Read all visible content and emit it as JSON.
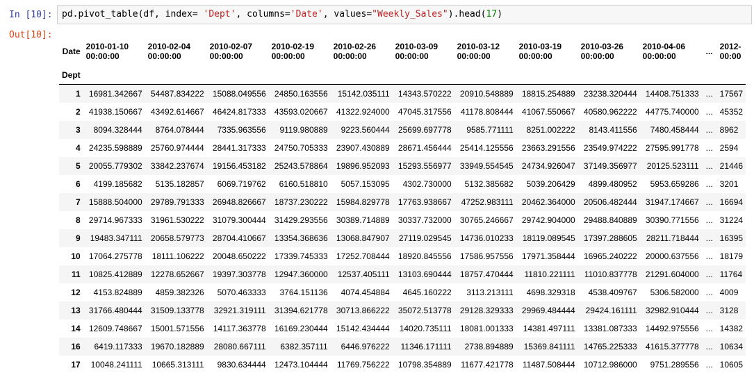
{
  "cell": {
    "in_prompt": "In [10]:",
    "out_prompt": "Out[10]:",
    "code": {
      "p1": "pd.pivot_table(df, index= ",
      "s1": "'Dept'",
      "p2": ", columns=",
      "s2": "'Date'",
      "p3": ", values=",
      "s3": "\"Weekly_Sales\"",
      "p4": ").head(",
      "n1": "17",
      "p5": ")"
    }
  },
  "table": {
    "columns_label": "Date",
    "index_label": "Dept",
    "ellipsis": "...",
    "columns": [
      [
        "2010-01-10",
        "00:00:00"
      ],
      [
        "2010-02-04",
        "00:00:00"
      ],
      [
        "2010-02-07",
        "00:00:00"
      ],
      [
        "2010-02-19",
        "00:00:00"
      ],
      [
        "2010-02-26",
        "00:00:00"
      ],
      [
        "2010-03-09",
        "00:00:00"
      ],
      [
        "2010-03-12",
        "00:00:00"
      ],
      [
        "2010-03-19",
        "00:00:00"
      ],
      [
        "2010-03-26",
        "00:00:00"
      ],
      [
        "2010-04-06",
        "00:00:00"
      ]
    ],
    "trunc_column": [
      "2012-",
      "00:00"
    ],
    "rows": [
      {
        "dept": "1",
        "values": [
          "16981.342667",
          "54487.834222",
          "15088.049556",
          "24850.163556",
          "15142.035111",
          "14343.570222",
          "20910.548889",
          "18815.254889",
          "23238.320444",
          "14408.751333"
        ],
        "tail": "17567"
      },
      {
        "dept": "2",
        "values": [
          "41938.150667",
          "43492.614667",
          "46424.817333",
          "43593.020667",
          "41322.924000",
          "47045.317556",
          "41178.808444",
          "41067.550667",
          "40580.962222",
          "44775.740000"
        ],
        "tail": "45352"
      },
      {
        "dept": "3",
        "values": [
          "8094.328444",
          "8764.078444",
          "7335.963556",
          "9119.980889",
          "9223.560444",
          "25699.697778",
          "9585.771111",
          "8251.002222",
          "8143.411556",
          "7480.458444"
        ],
        "tail": "8962"
      },
      {
        "dept": "4",
        "values": [
          "24235.598889",
          "25760.974444",
          "28441.317333",
          "24750.705333",
          "23907.430889",
          "28671.456444",
          "25414.125556",
          "23663.291556",
          "23549.974222",
          "27595.991778"
        ],
        "tail": "2594"
      },
      {
        "dept": "5",
        "values": [
          "20055.779302",
          "33842.237674",
          "19156.453182",
          "25243.578864",
          "19896.952093",
          "15293.556977",
          "33949.554545",
          "24734.926047",
          "37149.356977",
          "20125.523111"
        ],
        "tail": "21446"
      },
      {
        "dept": "6",
        "values": [
          "4199.185682",
          "5135.182857",
          "6069.719762",
          "6160.518810",
          "5057.153095",
          "4302.730000",
          "5132.385682",
          "5039.206429",
          "4899.480952",
          "5953.659286"
        ],
        "tail": "3201"
      },
      {
        "dept": "7",
        "values": [
          "15888.504000",
          "29789.791333",
          "26948.826667",
          "18737.230222",
          "15984.829778",
          "17763.938667",
          "47252.983111",
          "20462.364000",
          "20506.482444",
          "31947.174667"
        ],
        "tail": "16694"
      },
      {
        "dept": "8",
        "values": [
          "29714.967333",
          "31961.530222",
          "31079.300444",
          "31429.293556",
          "30389.714889",
          "30337.732000",
          "30765.246667",
          "29742.904000",
          "29488.840889",
          "30390.771556"
        ],
        "tail": "31224"
      },
      {
        "dept": "9",
        "values": [
          "19483.347111",
          "20658.579773",
          "28704.410667",
          "13354.368636",
          "13068.847907",
          "27119.029545",
          "14736.010233",
          "18119.089545",
          "17397.288605",
          "28211.718444"
        ],
        "tail": "16395"
      },
      {
        "dept": "10",
        "values": [
          "17064.275778",
          "18111.106222",
          "20048.650222",
          "17339.745333",
          "17252.708444",
          "18920.845556",
          "17586.957556",
          "17971.358444",
          "16965.240222",
          "20000.637556"
        ],
        "tail": "18179"
      },
      {
        "dept": "11",
        "values": [
          "10825.412889",
          "12278.652667",
          "19397.303778",
          "12947.360000",
          "12537.405111",
          "13103.690444",
          "18757.470444",
          "11810.221111",
          "11010.837778",
          "21291.604000"
        ],
        "tail": "11764"
      },
      {
        "dept": "12",
        "values": [
          "4153.824889",
          "4859.382326",
          "5070.463333",
          "3764.151136",
          "4074.454884",
          "4645.160222",
          "3113.213111",
          "4698.329318",
          "4538.409767",
          "5306.582000"
        ],
        "tail": "4009"
      },
      {
        "dept": "13",
        "values": [
          "31766.480444",
          "31509.133778",
          "32921.319111",
          "31394.621778",
          "30713.866222",
          "35072.513778",
          "29128.329333",
          "29969.484444",
          "29424.161111",
          "32982.910444"
        ],
        "tail": "3128"
      },
      {
        "dept": "14",
        "values": [
          "12609.748667",
          "15001.571556",
          "14117.363778",
          "16169.230444",
          "15142.434444",
          "14020.735111",
          "18081.001333",
          "14381.497111",
          "13381.087333",
          "14492.975556"
        ],
        "tail": "14382"
      },
      {
        "dept": "16",
        "values": [
          "6419.117333",
          "19670.182889",
          "28080.667111",
          "6382.357111",
          "6446.976222",
          "11346.171111",
          "2738.894889",
          "15369.841111",
          "14765.225333",
          "41615.377778"
        ],
        "tail": "10634"
      },
      {
        "dept": "17",
        "values": [
          "10048.241111",
          "10665.313111",
          "9830.634444",
          "12473.104444",
          "11769.756222",
          "10798.354889",
          "11677.421778",
          "11487.508444",
          "10712.986000",
          "9751.289556"
        ],
        "tail": "10605"
      }
    ]
  }
}
